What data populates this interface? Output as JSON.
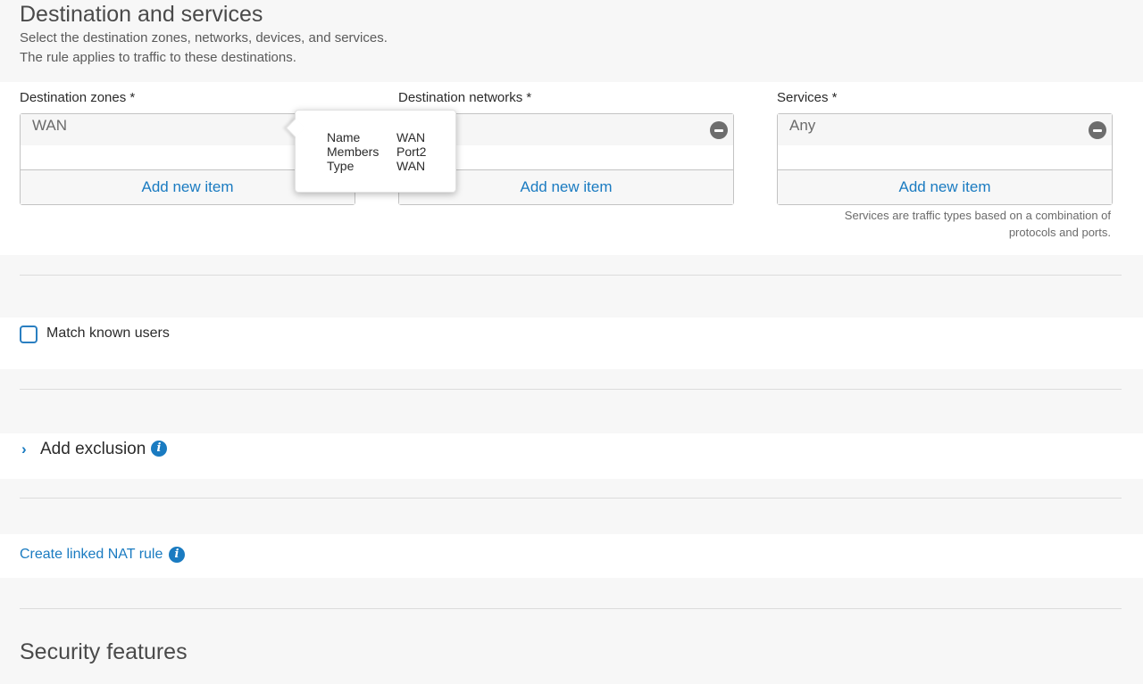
{
  "destination": {
    "title": "Destination and services",
    "desc_line1": "Select the destination zones, networks, devices, and services.",
    "desc_line2": "The rule applies to traffic to these destinations.",
    "zones": {
      "label": "Destination zones *",
      "item": "WAN",
      "add": "Add new item"
    },
    "networks": {
      "label": "Destination networks *",
      "item": "",
      "add": "Add new item"
    },
    "services": {
      "label": "Services *",
      "item": "Any",
      "add": "Add new item",
      "hint_line1": "Services are traffic types based on a combination of",
      "hint_line2": "protocols and ports."
    }
  },
  "tooltip": {
    "name_key": "Name",
    "name_val": "WAN",
    "members_key": "Members",
    "members_val": "Port2",
    "type_key": "Type",
    "type_val": "WAN"
  },
  "match_users": {
    "label": "Match known users",
    "checked": false
  },
  "exclusion": {
    "label": "Add exclusion",
    "chevron": "›"
  },
  "nat": {
    "label": "Create linked NAT rule"
  },
  "security": {
    "title": "Security features"
  },
  "icons": {
    "info": "i",
    "remove": "minus-circle-icon"
  },
  "colors": {
    "accent": "#1a7bc1",
    "background": "#f7f7f7"
  }
}
